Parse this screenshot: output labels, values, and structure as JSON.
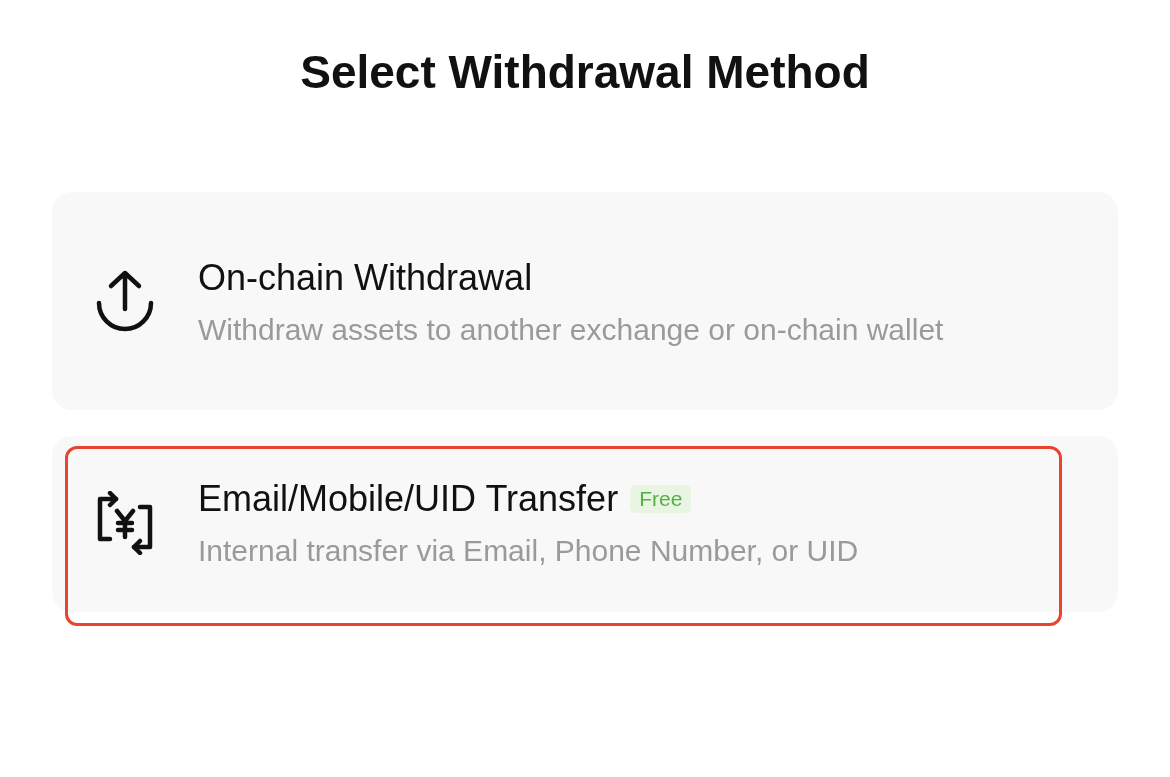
{
  "title": "Select Withdrawal Method",
  "options": [
    {
      "kind": "upload",
      "title": "On-chain Withdrawal",
      "description": "Withdraw assets to another exchange or on-chain wallet",
      "highlighted": false
    },
    {
      "kind": "transfer",
      "title": "Email/Mobile/UID Transfer",
      "badge": "Free",
      "description": "Internal transfer via Email, Phone Number, or UID",
      "highlighted": true
    }
  ]
}
